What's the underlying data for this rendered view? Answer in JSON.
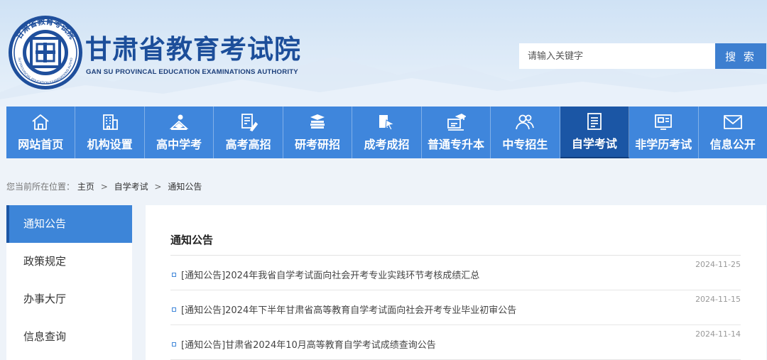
{
  "header": {
    "logo_ring_text": "甘肃省教育考试院",
    "logo_ring_text_en": "GANSU PROVINCIAL EDUCATION EXAMINATIONS AUTHORITY",
    "title": "甘肃省教育考试院",
    "subtitle": "GAN SU PROVINCAL EDUCATION EXAMINATIONS AUTHORITY",
    "search_placeholder": "请输入关键字",
    "search_button": "搜 索"
  },
  "nav": {
    "items": [
      {
        "label": "网站首页",
        "icon": "home-icon"
      },
      {
        "label": "机构设置",
        "icon": "building-icon"
      },
      {
        "label": "高中学考",
        "icon": "reading-icon"
      },
      {
        "label": "高考高招",
        "icon": "exam-pen-icon"
      },
      {
        "label": "研考研招",
        "icon": "books-icon"
      },
      {
        "label": "成考成招",
        "icon": "flag-cursor-icon"
      },
      {
        "label": "普通专升本",
        "icon": "graduation-screen-icon"
      },
      {
        "label": "中专招生",
        "icon": "people-icon"
      },
      {
        "label": "自学考试",
        "icon": "document-list-icon"
      },
      {
        "label": "非学历考试",
        "icon": "certificate-icon"
      },
      {
        "label": "信息公开",
        "icon": "mail-icon"
      }
    ],
    "active_index": 8
  },
  "breadcrumb": {
    "prefix": "您当前所在位置：",
    "items": [
      "主页",
      "自学考试",
      "通知公告"
    ],
    "separator": ">"
  },
  "sidebar": {
    "items": [
      "通知公告",
      "政策规定",
      "办事大厅",
      "信息查询"
    ],
    "active_index": 0
  },
  "main": {
    "title": "通知公告",
    "news": [
      {
        "title": "[通知公告]2024年我省自学考试面向社会开考专业实践环节考核成绩汇总",
        "date": "2024-11-25"
      },
      {
        "title": "[通知公告]2024年下半年甘肃省高等教育自学考试面向社会开考专业毕业初审公告",
        "date": "2024-11-15"
      },
      {
        "title": "[通知公告]甘肃省2024年10月高等教育自学考试成绩查询公告",
        "date": "2024-11-14"
      }
    ]
  },
  "colors": {
    "nav_bg": "#3f86dc",
    "nav_active": "#1b56a5",
    "title_blue": "#1c4e9a",
    "sidebar_active": "#3d85d8"
  }
}
